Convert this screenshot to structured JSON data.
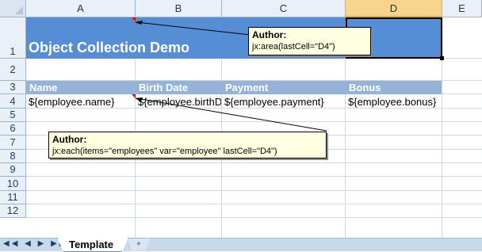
{
  "columns": [
    "A",
    "B",
    "C",
    "D",
    "E"
  ],
  "selected_column": "D",
  "rows": [
    "1",
    "2",
    "3",
    "4",
    "5",
    "6",
    "7",
    "8",
    "9",
    "10",
    "11",
    "12"
  ],
  "title": "Object Collection Demo",
  "headers": {
    "a3": "Name",
    "b3": "Birth Date",
    "c3": "Payment",
    "d3": "Bonus"
  },
  "row4": {
    "a4": "${employee.name}",
    "b4": "${employee.birthDate}",
    "c4": "${employee.payment}",
    "d4": "${employee.bonus}"
  },
  "comments": {
    "area": {
      "author": "Author:",
      "text": "jx:area(lastCell=\"D4\")"
    },
    "each": {
      "author": "Author:",
      "text": "jx:each(items=\"employees\" var=\"employee\" lastCell=\"D4\")"
    }
  },
  "sheet_tabs": {
    "active": "Template"
  },
  "colors": {
    "title_fill": "#558ed5",
    "header_fill": "#95b3d7",
    "comment_fill": "#ffffe1"
  },
  "icons": {
    "nav": "sheet-nav-arrows-icon",
    "new_sheet": "insert-sheet-icon"
  }
}
